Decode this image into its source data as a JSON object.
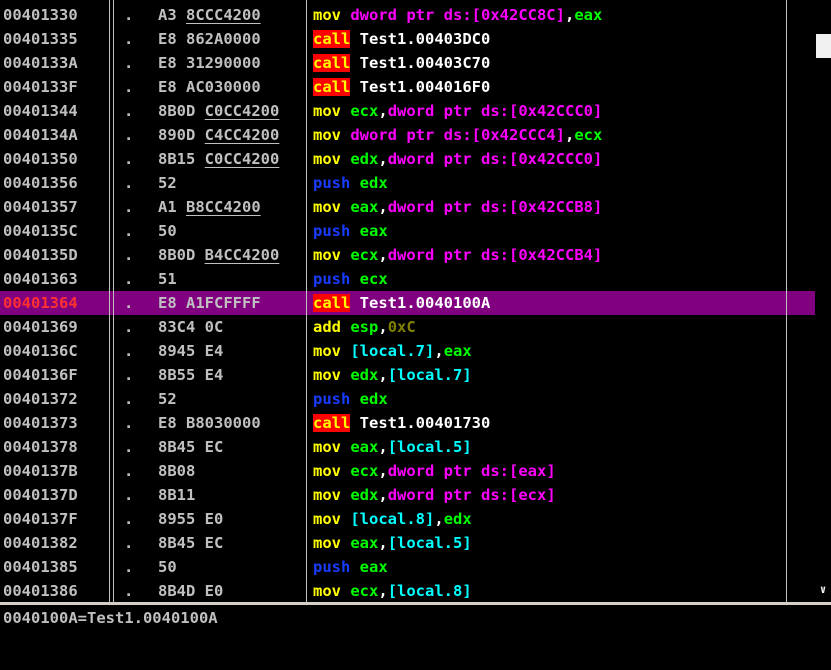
{
  "colors": {
    "background": "#000000",
    "selection": "#800080",
    "address": "#c0c0c0",
    "current_address": "#ff3030",
    "mnemonic": "#ffff00",
    "push": "#1a3cff",
    "call_bg": "#ff0000",
    "register": "#00ff00",
    "memory": "#ff00ff",
    "local": "#00ffff"
  },
  "rows": [
    {
      "addr": "00401330",
      "dot": ".",
      "hex": [
        {
          "t": "A3 "
        },
        {
          "t": "8CCC4200",
          "u": 1
        }
      ],
      "mn": "mov",
      "ops": [
        {
          "t": "dword ptr ds:[0x42CC8C]",
          "c": "mem"
        },
        {
          "t": ",",
          "c": "pun"
        },
        {
          "t": "eax",
          "c": "reg"
        }
      ]
    },
    {
      "addr": "00401335",
      "dot": ".",
      "hex": [
        {
          "t": "E8 862A0000"
        }
      ],
      "mn": "call",
      "ops": [
        {
          "t": "Test1.00403DC0",
          "c": "text"
        }
      ]
    },
    {
      "addr": "0040133A",
      "dot": ".",
      "hex": [
        {
          "t": "E8 31290000"
        }
      ],
      "mn": "call",
      "ops": [
        {
          "t": "Test1.00403C70",
          "c": "text"
        }
      ]
    },
    {
      "addr": "0040133F",
      "dot": ".",
      "hex": [
        {
          "t": "E8 AC030000"
        }
      ],
      "mn": "call",
      "ops": [
        {
          "t": "Test1.004016F0",
          "c": "text"
        }
      ]
    },
    {
      "addr": "00401344",
      "dot": ".",
      "hex": [
        {
          "t": "8B0D "
        },
        {
          "t": "C0CC4200",
          "u": 1
        }
      ],
      "mn": "mov",
      "ops": [
        {
          "t": "ecx",
          "c": "reg"
        },
        {
          "t": ",",
          "c": "pun"
        },
        {
          "t": "dword ptr ds:[0x42CCC0]",
          "c": "mem"
        }
      ]
    },
    {
      "addr": "0040134A",
      "dot": ".",
      "hex": [
        {
          "t": "890D "
        },
        {
          "t": "C4CC4200",
          "u": 1
        }
      ],
      "mn": "mov",
      "ops": [
        {
          "t": "dword ptr ds:[0x42CCC4]",
          "c": "mem"
        },
        {
          "t": ",",
          "c": "pun"
        },
        {
          "t": "ecx",
          "c": "reg"
        }
      ]
    },
    {
      "addr": "00401350",
      "dot": ".",
      "hex": [
        {
          "t": "8B15 "
        },
        {
          "t": "C0CC4200",
          "u": 1
        }
      ],
      "mn": "mov",
      "ops": [
        {
          "t": "edx",
          "c": "reg"
        },
        {
          "t": ",",
          "c": "pun"
        },
        {
          "t": "dword ptr ds:[0x42CCC0]",
          "c": "mem"
        }
      ]
    },
    {
      "addr": "00401356",
      "dot": ".",
      "hex": [
        {
          "t": "52"
        }
      ],
      "mn": "push",
      "ops": [
        {
          "t": "edx",
          "c": "reg"
        }
      ]
    },
    {
      "addr": "00401357",
      "dot": ".",
      "hex": [
        {
          "t": "A1 "
        },
        {
          "t": "B8CC4200",
          "u": 1
        }
      ],
      "mn": "mov",
      "ops": [
        {
          "t": "eax",
          "c": "reg"
        },
        {
          "t": ",",
          "c": "pun"
        },
        {
          "t": "dword ptr ds:[0x42CCB8]",
          "c": "mem"
        }
      ]
    },
    {
      "addr": "0040135C",
      "dot": ".",
      "hex": [
        {
          "t": "50"
        }
      ],
      "mn": "push",
      "ops": [
        {
          "t": "eax",
          "c": "reg"
        }
      ]
    },
    {
      "addr": "0040135D",
      "dot": ".",
      "hex": [
        {
          "t": "8B0D "
        },
        {
          "t": "B4CC4200",
          "u": 1
        }
      ],
      "mn": "mov",
      "ops": [
        {
          "t": "ecx",
          "c": "reg"
        },
        {
          "t": ",",
          "c": "pun"
        },
        {
          "t": "dword ptr ds:[0x42CCB4]",
          "c": "mem"
        }
      ]
    },
    {
      "addr": "00401363",
      "dot": ".",
      "hex": [
        {
          "t": "51"
        }
      ],
      "mn": "push",
      "ops": [
        {
          "t": "ecx",
          "c": "reg"
        }
      ]
    },
    {
      "addr": "00401364",
      "dot": ".",
      "hex": [
        {
          "t": "E8 A1FCFFFF"
        }
      ],
      "mn": "call",
      "ops": [
        {
          "t": "Test1.0040100A",
          "c": "text"
        }
      ],
      "selected": true
    },
    {
      "addr": "00401369",
      "dot": ".",
      "hex": [
        {
          "t": "83C4 0C"
        }
      ],
      "mn": "add",
      "ops": [
        {
          "t": "esp",
          "c": "reg"
        },
        {
          "t": ",",
          "c": "pun"
        },
        {
          "t": "0xC",
          "c": "num"
        }
      ]
    },
    {
      "addr": "0040136C",
      "dot": ".",
      "hex": [
        {
          "t": "8945 E4"
        }
      ],
      "mn": "mov",
      "ops": [
        {
          "t": "[local.7]",
          "c": "loc"
        },
        {
          "t": ",",
          "c": "pun"
        },
        {
          "t": "eax",
          "c": "reg"
        }
      ]
    },
    {
      "addr": "0040136F",
      "dot": ".",
      "hex": [
        {
          "t": "8B55 E4"
        }
      ],
      "mn": "mov",
      "ops": [
        {
          "t": "edx",
          "c": "reg"
        },
        {
          "t": ",",
          "c": "pun"
        },
        {
          "t": "[local.7]",
          "c": "loc"
        }
      ]
    },
    {
      "addr": "00401372",
      "dot": ".",
      "hex": [
        {
          "t": "52"
        }
      ],
      "mn": "push",
      "ops": [
        {
          "t": "edx",
          "c": "reg"
        }
      ]
    },
    {
      "addr": "00401373",
      "dot": ".",
      "hex": [
        {
          "t": "E8 B8030000"
        }
      ],
      "mn": "call",
      "ops": [
        {
          "t": "Test1.00401730",
          "c": "text"
        }
      ]
    },
    {
      "addr": "00401378",
      "dot": ".",
      "hex": [
        {
          "t": "8B45 EC"
        }
      ],
      "mn": "mov",
      "ops": [
        {
          "t": "eax",
          "c": "reg"
        },
        {
          "t": ",",
          "c": "pun"
        },
        {
          "t": "[local.5]",
          "c": "loc"
        }
      ]
    },
    {
      "addr": "0040137B",
      "dot": ".",
      "hex": [
        {
          "t": "8B08"
        }
      ],
      "mn": "mov",
      "ops": [
        {
          "t": "ecx",
          "c": "reg"
        },
        {
          "t": ",",
          "c": "pun"
        },
        {
          "t": "dword ptr ds:[eax]",
          "c": "mem"
        }
      ]
    },
    {
      "addr": "0040137D",
      "dot": ".",
      "hex": [
        {
          "t": "8B11"
        }
      ],
      "mn": "mov",
      "ops": [
        {
          "t": "edx",
          "c": "reg"
        },
        {
          "t": ",",
          "c": "pun"
        },
        {
          "t": "dword ptr ds:[ecx]",
          "c": "mem"
        }
      ]
    },
    {
      "addr": "0040137F",
      "dot": ".",
      "hex": [
        {
          "t": "8955 E0"
        }
      ],
      "mn": "mov",
      "ops": [
        {
          "t": "[local.8]",
          "c": "loc"
        },
        {
          "t": ",",
          "c": "pun"
        },
        {
          "t": "edx",
          "c": "reg"
        }
      ]
    },
    {
      "addr": "00401382",
      "dot": ".",
      "hex": [
        {
          "t": "8B45 EC"
        }
      ],
      "mn": "mov",
      "ops": [
        {
          "t": "eax",
          "c": "reg"
        },
        {
          "t": ",",
          "c": "pun"
        },
        {
          "t": "[local.5]",
          "c": "loc"
        }
      ]
    },
    {
      "addr": "00401385",
      "dot": ".",
      "hex": [
        {
          "t": "50"
        }
      ],
      "mn": "push",
      "ops": [
        {
          "t": "eax",
          "c": "reg"
        }
      ]
    },
    {
      "addr": "00401386",
      "dot": ".",
      "hex": [
        {
          "t": "8B4D E0"
        }
      ],
      "mn": "mov",
      "ops": [
        {
          "t": "ecx",
          "c": "reg"
        },
        {
          "t": ",",
          "c": "pun"
        },
        {
          "t": "[local.8]",
          "c": "loc"
        }
      ]
    }
  ],
  "info_pane": {
    "text": "0040100A=Test1.0040100A"
  },
  "scrollbar": {
    "down_arrow_icon": "chevron-down-icon"
  }
}
